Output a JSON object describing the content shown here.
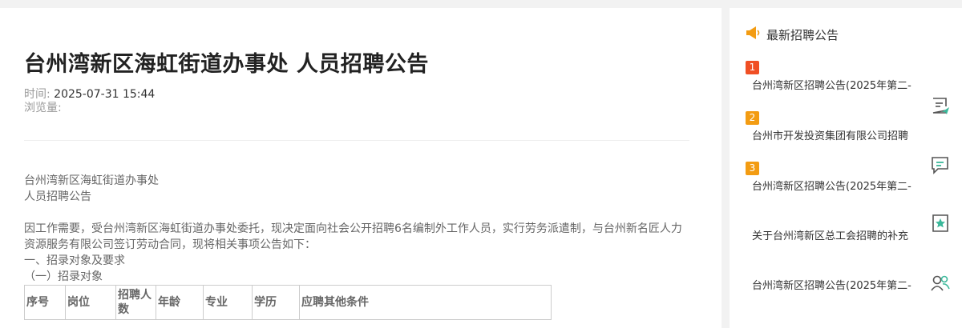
{
  "article": {
    "title": "台州湾新区海虹街道办事处 人员招聘公告",
    "time_label": "时间:",
    "time_value": "2025-07-31 15:44",
    "views_label": "浏览量:",
    "views_value": "",
    "body": {
      "line1": "台州湾新区海虹街道办事处",
      "line2": "人员招聘公告",
      "para": "因工作需要，受台州湾新区海虹街道办事处委托，现决定面向社会公开招聘6名编制外工作人员，实行劳务派遣制，与台州新名匠人力资源服务有限公司签订劳动合同，现将相关事项公告如下：",
      "section1": "一、招录对象及要求",
      "section1_1": "（一）招录对象"
    },
    "table_headers": [
      "序号",
      "岗位",
      "招聘人数",
      "年龄",
      "专业",
      "学历",
      "应聘其他条件"
    ]
  },
  "sidebar": {
    "title": "最新招聘公告",
    "title_icon": "megaphone-icon",
    "items": [
      {
        "rank": "1",
        "text": "台州湾新区招聘公告(2025年第二-"
      },
      {
        "rank": "2",
        "text": "台州市开发投资集团有限公司招聘"
      },
      {
        "rank": "3",
        "text": "台州湾新区招聘公告(2025年第二-"
      },
      {
        "rank": "",
        "text": "关于台州湾新区总工会招聘的补充"
      },
      {
        "rank": "",
        "text": "台州湾新区招聘公告(2025年第二-"
      }
    ]
  },
  "floating_tools": [
    "edit-message-icon",
    "comment-icon",
    "favorite-icon",
    "users-icon"
  ],
  "colors": {
    "rank1": "#f04f24",
    "rank2": "#f39c12",
    "rank3": "#f39c12",
    "accent": "#f39c12",
    "tool": "#3ab89a"
  }
}
